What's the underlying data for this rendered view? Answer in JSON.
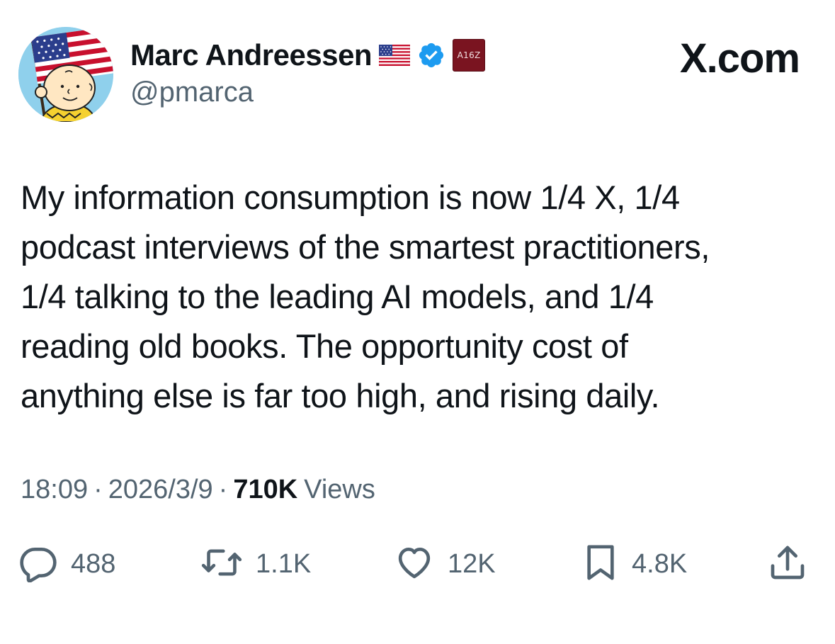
{
  "author": {
    "display_name": "Marc Andreessen",
    "handle": "@pmarca",
    "affiliate_badge_text": "A16Z",
    "icons": [
      "avatar",
      "us-flag-icon",
      "verified-icon",
      "affiliate-badge"
    ]
  },
  "brand": {
    "label": "X.com"
  },
  "tweet": {
    "lines": [
      "My information consumption is now 1/4 X, 1/4",
      "podcast interviews of the smartest practitioners,",
      "1/4 talking to the leading AI models, and 1/4",
      "reading old books. The opportunity cost of",
      "anything else is far too high, and rising daily."
    ]
  },
  "meta": {
    "time": "18:09",
    "separator": "·",
    "date": "2026/3/9",
    "views_count": "710K",
    "views_label": "Views"
  },
  "actions": {
    "replies": "488",
    "reposts": "1.1K",
    "likes": "12K",
    "bookmarks": "4.8K"
  },
  "colors": {
    "text_primary": "#0f1419",
    "text_secondary": "#536471",
    "verified_blue": "#1d9bf0",
    "affiliate_red": "#7a1420",
    "avatar_sky": "#8fd0ec"
  }
}
